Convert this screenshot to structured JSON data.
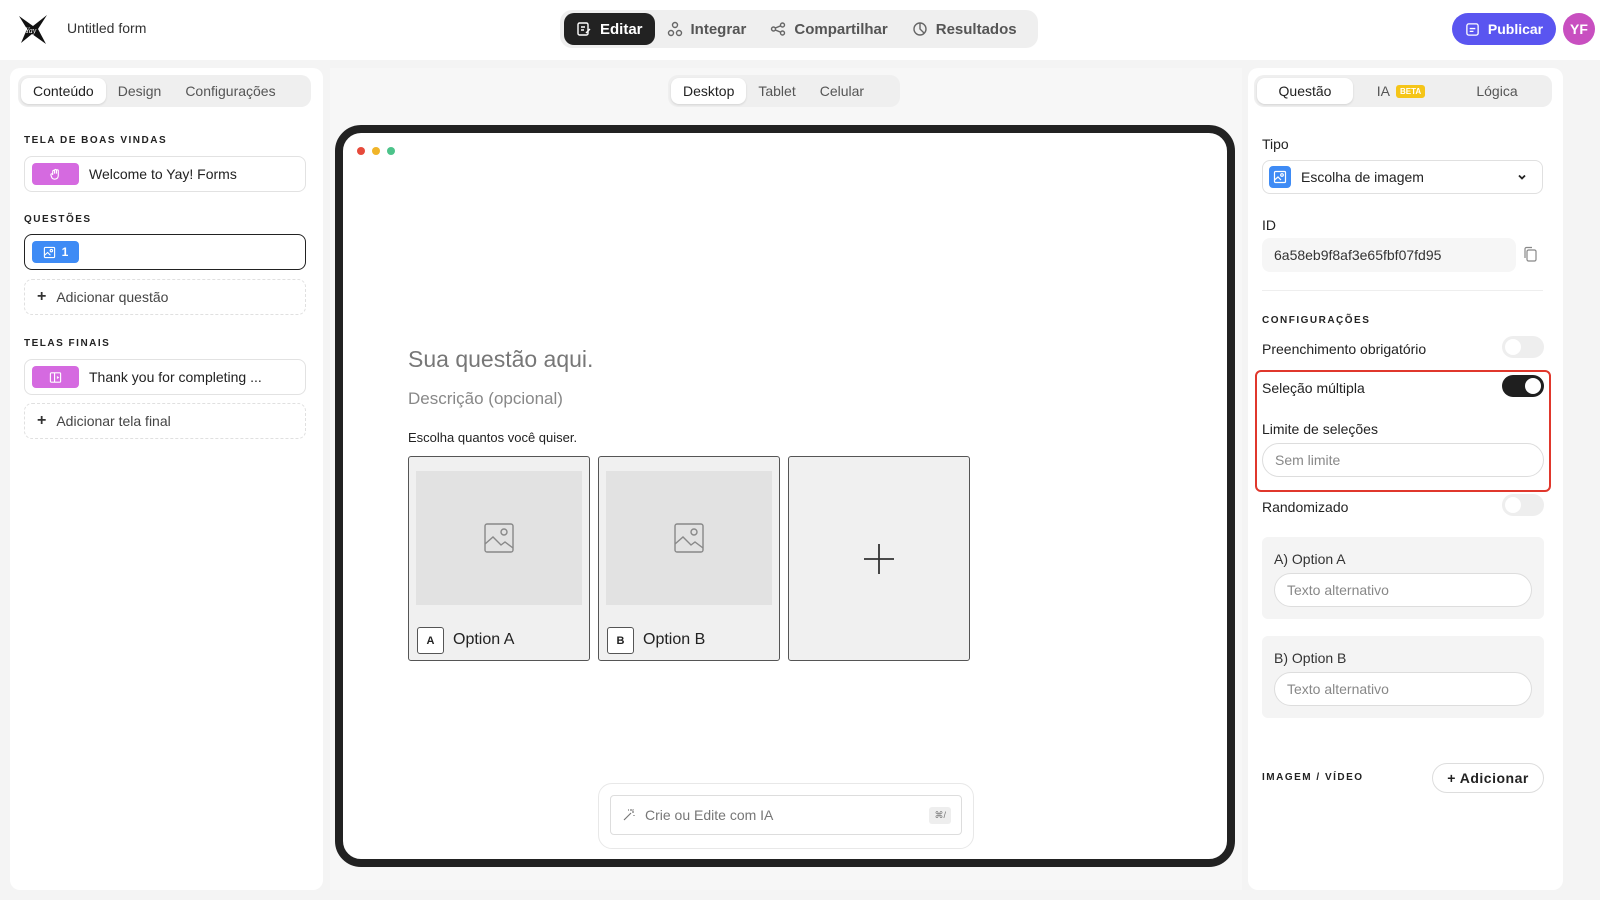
{
  "header": {
    "form_title": "Untitled form",
    "nav": [
      {
        "label": "Editar",
        "icon": "edit-icon",
        "active": true
      },
      {
        "label": "Integrar",
        "icon": "integrate-icon",
        "active": false
      },
      {
        "label": "Compartilhar",
        "icon": "share-icon",
        "active": false
      },
      {
        "label": "Resultados",
        "icon": "results-icon",
        "active": false
      }
    ],
    "publish_label": "Publicar",
    "avatar_initials": "YF"
  },
  "left": {
    "tabs": [
      "Conteúdo",
      "Design",
      "Configurações"
    ],
    "active_tab": "Conteúdo",
    "welcome_heading": "TELA DE BOAS VINDAS",
    "welcome_item": "Welcome to Yay! Forms",
    "questions_heading": "QUESTÕES",
    "question_number": "1",
    "add_question": "Adicionar questão",
    "endings_heading": "TELAS FINAIS",
    "ending_item": "Thank you for completing ...",
    "add_ending": "Adicionar tela final"
  },
  "center": {
    "device_tabs": [
      "Desktop",
      "Tablet",
      "Celular"
    ],
    "active_device": "Desktop",
    "question_title": "Sua questão aqui.",
    "question_description": "Descrição (opcional)",
    "hint": "Escolha quantos você quiser.",
    "options": [
      {
        "key": "A",
        "label": "Option A"
      },
      {
        "key": "B",
        "label": "Option B"
      }
    ],
    "ai_placeholder": "Crie ou Edite com IA",
    "ai_shortcut": "⌘/"
  },
  "right": {
    "tabs": [
      "Questão",
      "IA",
      "Lógica"
    ],
    "beta_badge": "BETA",
    "active_tab": "Questão",
    "type_label": "Tipo",
    "type_value": "Escolha de imagem",
    "id_label": "ID",
    "id_value": "6a58eb9f8af3e65fbf07fd95",
    "settings_heading": "CONFIGURAÇÕES",
    "required_label": "Preenchimento obrigatório",
    "required_on": false,
    "multiple_label": "Seleção múltipla",
    "multiple_on": true,
    "limit_label": "Limite de seleções",
    "limit_placeholder": "Sem limite",
    "random_label": "Randomizado",
    "random_on": false,
    "option_a_label": "A) Option A",
    "option_b_label": "B) Option B",
    "alt_placeholder": "Texto alternativo",
    "media_heading": "IMAGEM / VÍDEO",
    "add_media": "+ Adicionar"
  },
  "colors": {
    "accent": "#5a55f0",
    "avatar": "#c84fc0",
    "chip_pink": "#d56ae0",
    "chip_blue": "#3e8bf5",
    "highlight": "#e0372c",
    "beta": "#f5c518",
    "dot_red": "#e64a3b",
    "dot_yellow": "#f0b429",
    "dot_green": "#4cc38a"
  }
}
